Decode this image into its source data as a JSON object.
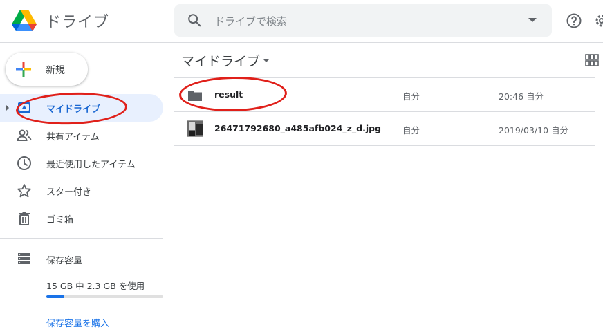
{
  "app": {
    "name": "ドライブ"
  },
  "search": {
    "placeholder": "ドライブで検索"
  },
  "sidebar": {
    "new_label": "新規",
    "items": [
      {
        "label": "マイドライブ",
        "icon": "my-drive-icon",
        "active": true
      },
      {
        "label": "共有アイテム",
        "icon": "shared-icon"
      },
      {
        "label": "最近使用したアイテム",
        "icon": "clock-icon"
      },
      {
        "label": "スター付き",
        "icon": "star-icon"
      },
      {
        "label": "ゴミ箱",
        "icon": "trash-icon"
      }
    ],
    "storage": {
      "label": "保存容量",
      "usage": "15 GB 中 2.3 GB を使用",
      "used_fraction": 0.153,
      "buy_label": "保存容量を購入"
    }
  },
  "main": {
    "title": "マイドライブ",
    "files": [
      {
        "name": "result",
        "type": "folder",
        "owner": "自分",
        "modified": "20:46 自分"
      },
      {
        "name": "26471792680_a485afb024_z_d.jpg",
        "type": "image",
        "owner": "自分",
        "modified": "2019/03/10 自分"
      }
    ]
  },
  "colors": {
    "accent": "#1a73e8",
    "active_bg": "#e8f0fe",
    "annotation": "#e0201a"
  }
}
